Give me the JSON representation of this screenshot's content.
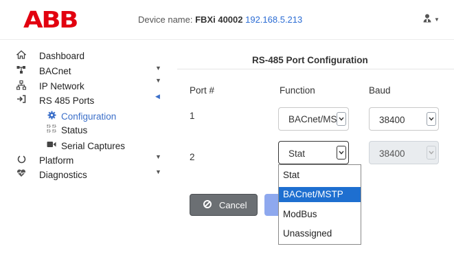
{
  "header": {
    "logo": "ABB",
    "device_label": "Device name:",
    "device_name": "FBXi 40002",
    "device_ip": "192.168.5.213",
    "user_icon": "user-icon"
  },
  "nav": {
    "items": [
      {
        "label": "Dashboard",
        "icon": "home-icon"
      },
      {
        "label": "BACnet",
        "icon": "network-tree-icon"
      },
      {
        "label": "IP Network",
        "icon": "sitemap-icon"
      },
      {
        "label": "RS 485 Ports",
        "icon": "sign-in-icon"
      },
      {
        "label": "Configuration",
        "icon": "gear-icon"
      },
      {
        "label": "Status",
        "icon": "status-icon"
      },
      {
        "label": "Serial Captures",
        "icon": "video-icon"
      },
      {
        "label": "Platform",
        "icon": "circle-icon"
      },
      {
        "label": "Diagnostics",
        "icon": "heartbeat-icon"
      }
    ]
  },
  "main": {
    "title": "RS-485 Port Configuration",
    "headers": {
      "port": "Port #",
      "function": "Function",
      "baud": "Baud"
    },
    "rows": [
      {
        "port": "1",
        "function": "BACnet/MSTP",
        "baud": "38400"
      },
      {
        "port": "2",
        "function": "Stat",
        "baud": "38400"
      }
    ],
    "dropdown_options": [
      "Stat",
      "BACnet/MSTP",
      "ModBus",
      "Unassigned"
    ],
    "highlighted_option": "BACnet/MSTP",
    "cancel_label": "Cancel"
  },
  "colors": {
    "brand": "#e2000f",
    "link": "#2b6cd4",
    "highlight": "#1e6fd0",
    "cancel_button": "#6b6f73"
  }
}
